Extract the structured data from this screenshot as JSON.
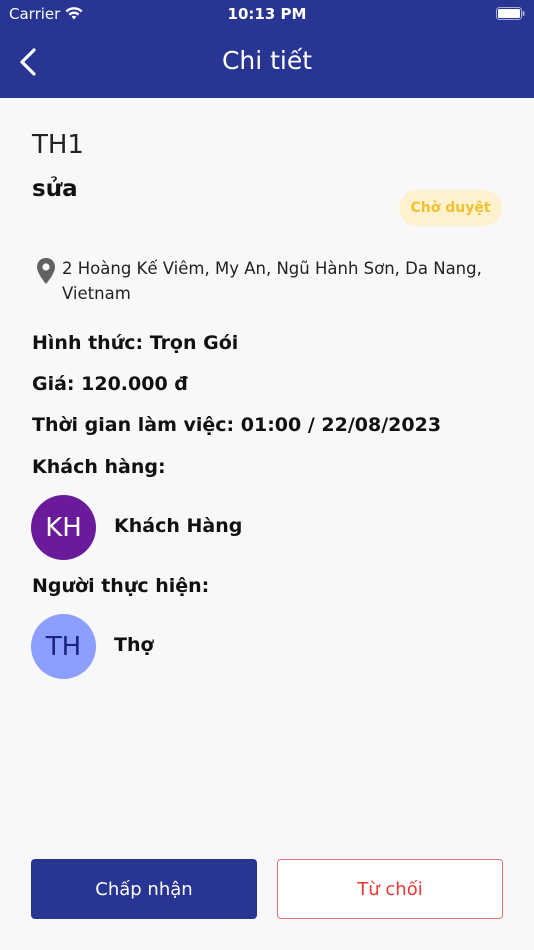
{
  "status_bar": {
    "carrier": "Carrier",
    "time": "10:13 PM"
  },
  "header": {
    "title": "Chi tiết",
    "back_icon": "chevron-left-icon"
  },
  "job": {
    "code": "TH1",
    "service": "sửa",
    "status": "Chờ duyệt",
    "status_color": "#f2c12e",
    "address": "2 Hoàng Kế Viêm, My An, Ngũ Hành Sơn, Da Nang, Vietnam",
    "form": "Hình thức: Trọn Gói",
    "price": "Giá: 120.000 đ",
    "work_time": "Thời gian làm việc: 01:00 / 22/08/2023"
  },
  "customer": {
    "label": "Khách hàng:",
    "initials": "KH",
    "name": "Khách Hàng",
    "avatar_color": "#6a1b9a"
  },
  "worker": {
    "label": "Người thực hiện:",
    "initials": "TH",
    "name": "Thợ",
    "avatar_color": "#8c9eff"
  },
  "actions": {
    "accept": "Chấp nhận",
    "reject": "Từ chối"
  },
  "colors": {
    "primary": "#283593",
    "danger": "#e53935"
  }
}
